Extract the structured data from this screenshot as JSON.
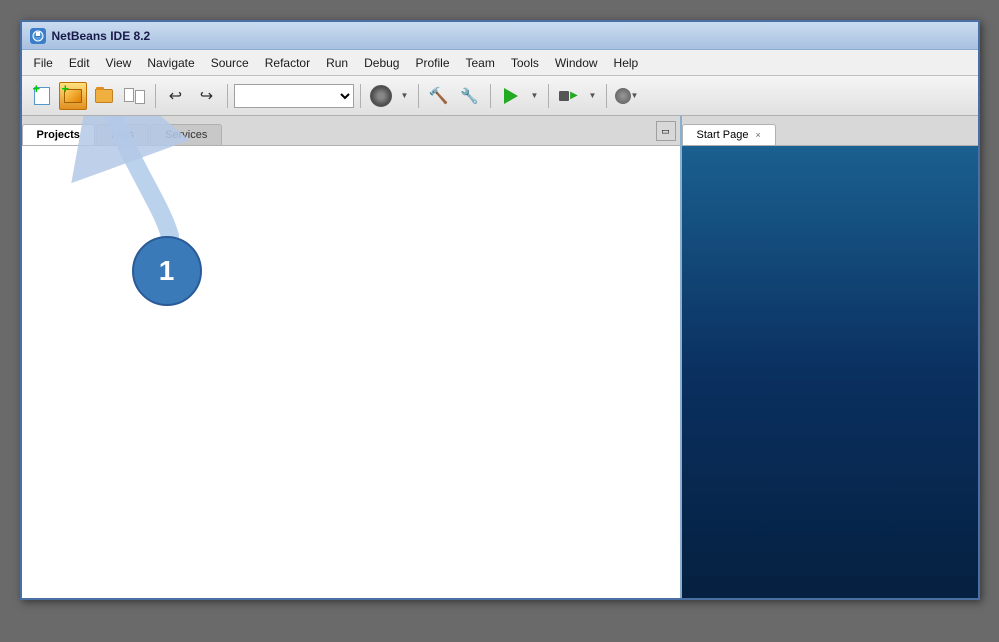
{
  "window": {
    "title": "NetBeans IDE 8.2",
    "icon": "nb"
  },
  "menubar": {
    "items": [
      {
        "id": "file",
        "label": "File"
      },
      {
        "id": "edit",
        "label": "Edit"
      },
      {
        "id": "view",
        "label": "View"
      },
      {
        "id": "navigate",
        "label": "Navigate"
      },
      {
        "id": "source",
        "label": "Source"
      },
      {
        "id": "refactor",
        "label": "Refactor"
      },
      {
        "id": "run",
        "label": "Run"
      },
      {
        "id": "debug",
        "label": "Debug"
      },
      {
        "id": "profile",
        "label": "Profile"
      },
      {
        "id": "team",
        "label": "Team"
      },
      {
        "id": "tools",
        "label": "Tools"
      },
      {
        "id": "window",
        "label": "Window"
      },
      {
        "id": "help",
        "label": "Help"
      }
    ]
  },
  "left_panel": {
    "tabs": [
      {
        "id": "projects",
        "label": "Projects",
        "active": true
      },
      {
        "id": "files",
        "label": "Files",
        "active": false
      },
      {
        "id": "services",
        "label": "Services",
        "active": false
      }
    ]
  },
  "right_panel": {
    "tab_label": "Start Page",
    "tab_close": "×"
  },
  "annotation": {
    "circle_number": "1"
  },
  "toolbar": {
    "combo_placeholder": ""
  }
}
